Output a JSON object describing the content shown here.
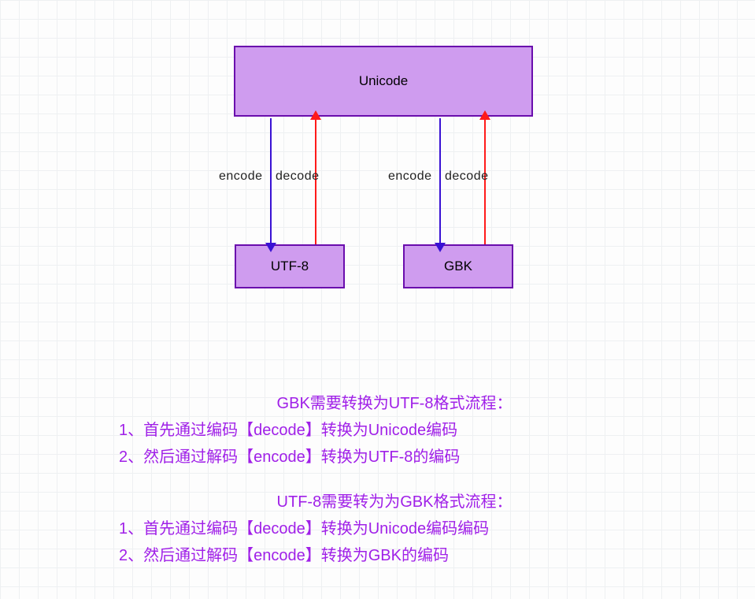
{
  "boxes": {
    "unicode": "Unicode",
    "utf8": "UTF-8",
    "gbk": "GBK"
  },
  "arrow_labels": {
    "encode": "encode",
    "decode": "decode"
  },
  "explanations": {
    "gbk_to_utf8": {
      "title": "GBK需要转换为UTF-8格式流程：",
      "step1": "1、首先通过编码【decode】转换为Unicode编码",
      "step2": "2、然后通过解码【encode】转换为UTF-8的编码"
    },
    "utf8_to_gbk": {
      "title": "UTF-8需要转为为GBK格式流程：",
      "step1": "1、首先通过编码【decode】转换为Unicode编码编码",
      "step2": "2、然后通过解码【encode】转换为GBK的编码"
    }
  }
}
